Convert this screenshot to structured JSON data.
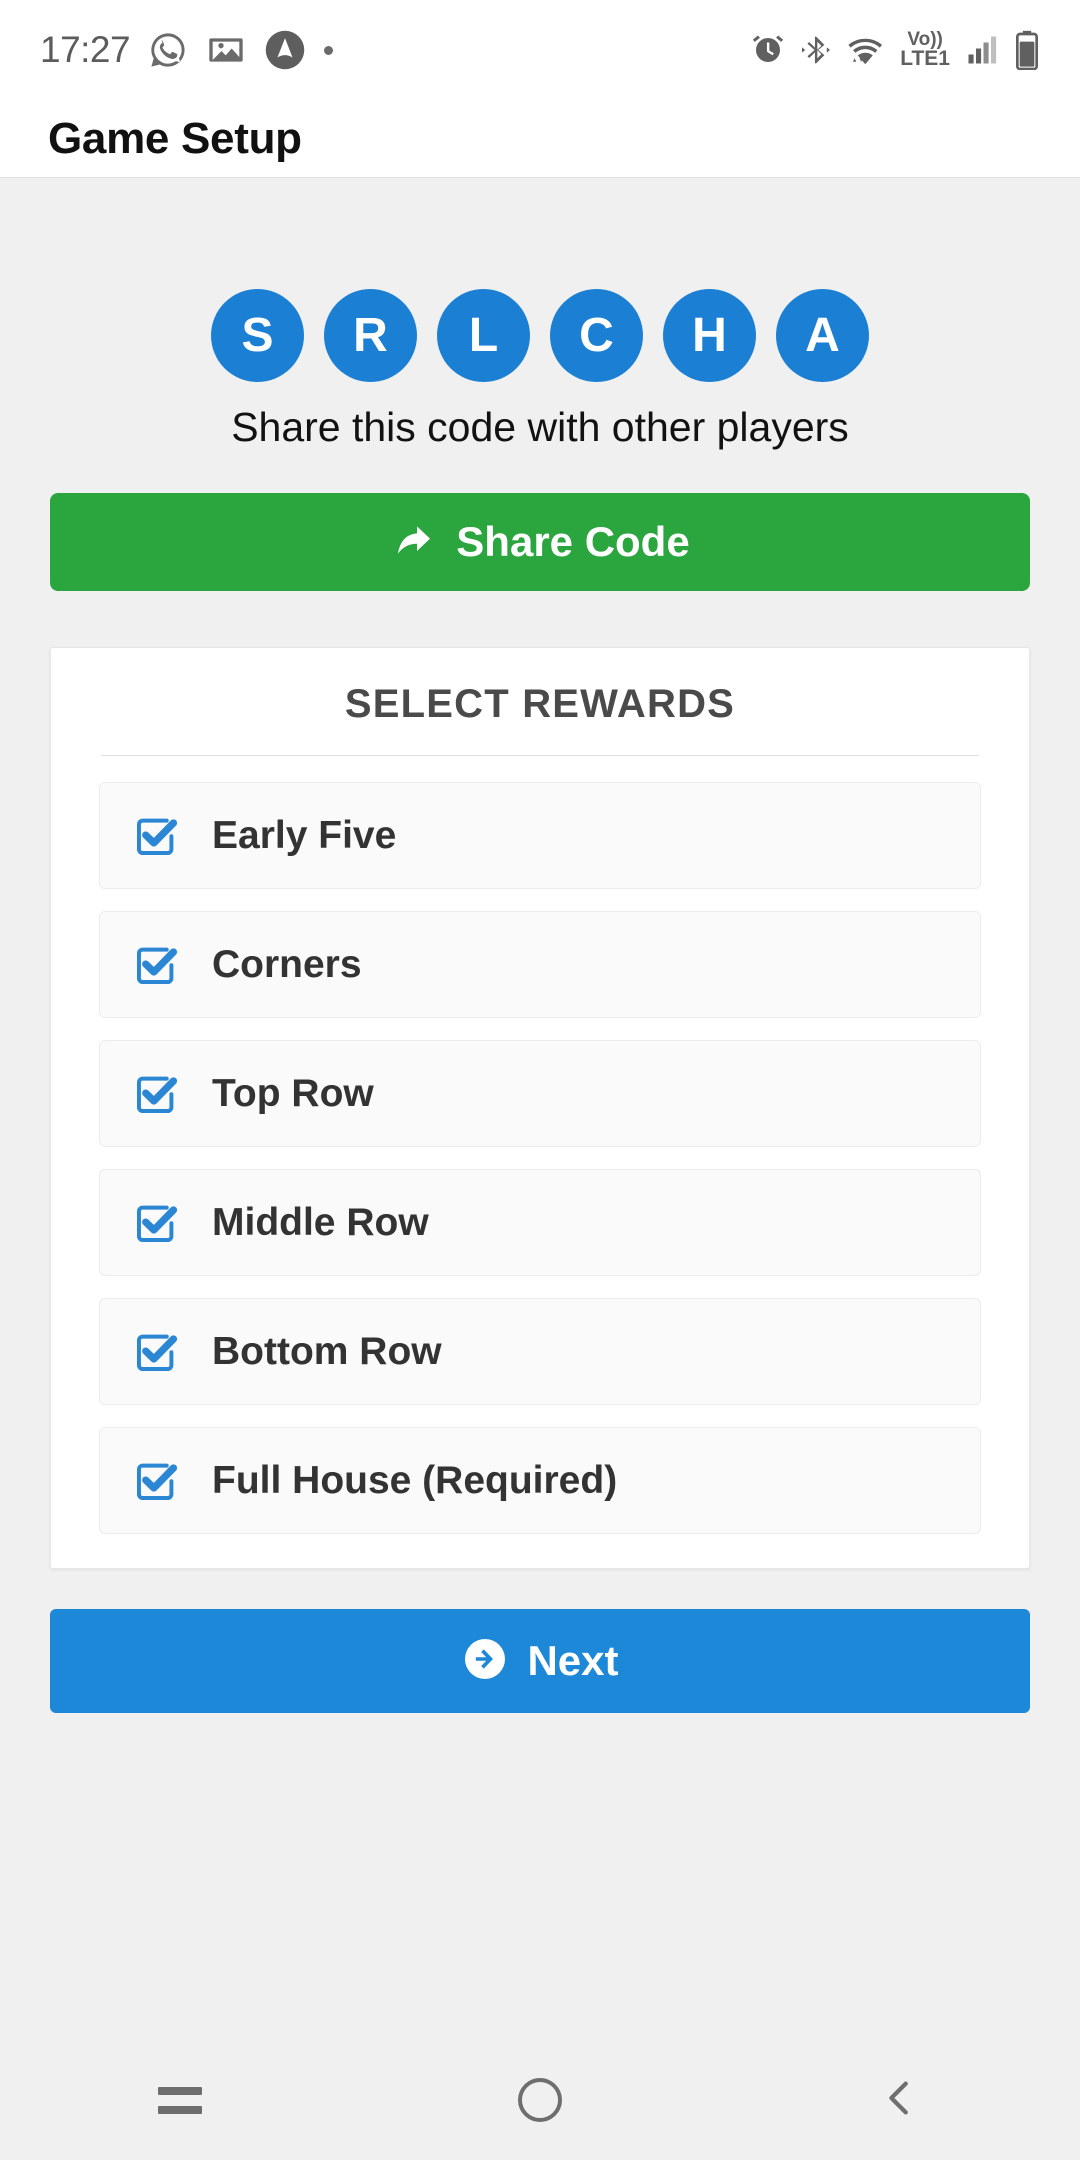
{
  "statusbar": {
    "time": "17:27",
    "left_icons": [
      "whatsapp-icon",
      "gallery-icon",
      "app-icon",
      "dot-indicator"
    ],
    "right_icons": [
      "alarm-icon",
      "bluetooth-icon",
      "wifi-icon",
      "volte-icon",
      "signal-icon",
      "battery-icon"
    ],
    "volte_top": "Vo))",
    "volte_bottom": "LTE1"
  },
  "appbar": {
    "title": "Game Setup"
  },
  "game_code": {
    "letters": [
      "S",
      "R",
      "L",
      "C",
      "H",
      "A"
    ],
    "hint": "Share this code with other players",
    "circle_color": "#1b7fd4"
  },
  "share_button": {
    "label": "Share Code",
    "icon": "share-arrow-icon",
    "color": "#2ba63f"
  },
  "rewards": {
    "title": "SELECT REWARDS",
    "items": [
      {
        "label": "Early Five",
        "checked": true
      },
      {
        "label": "Corners",
        "checked": true
      },
      {
        "label": "Top Row",
        "checked": true
      },
      {
        "label": "Middle Row",
        "checked": true
      },
      {
        "label": "Bottom Row",
        "checked": true
      },
      {
        "label": "Full House (Required)",
        "checked": true
      }
    ],
    "check_color": "#2b87d4"
  },
  "next_button": {
    "label": "Next",
    "icon": "arrow-circle-right-icon",
    "color": "#1e88d8"
  },
  "navbar": {
    "recents": "recents-icon",
    "home": "home-icon",
    "back": "back-icon"
  }
}
